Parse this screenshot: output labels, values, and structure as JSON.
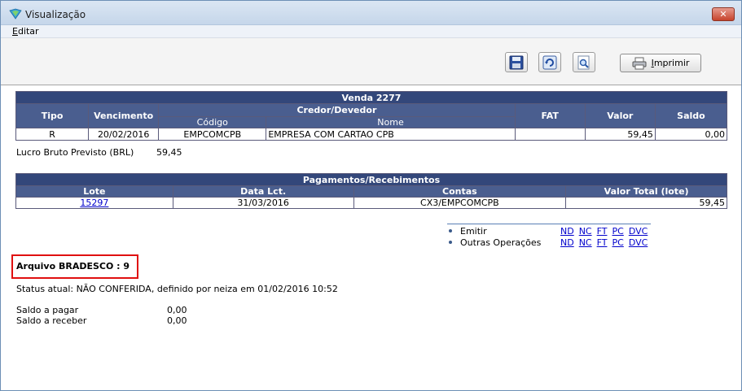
{
  "window": {
    "title": "Visualização",
    "close_label": "✕"
  },
  "menu": {
    "editar": "Editar"
  },
  "toolbar": {
    "print_label": "Imprimir"
  },
  "venda": {
    "title": "Venda  2277",
    "headers": {
      "tipo": "Tipo",
      "vencimento": "Vencimento",
      "credor_devedor": "Credor/Devedor",
      "codigo": "Código",
      "nome": "Nome",
      "fat": "FAT",
      "valor": "Valor",
      "saldo": "Saldo"
    },
    "row": {
      "tipo": "R",
      "vencimento": "20/02/2016",
      "codigo": "EMPCOMCPB",
      "nome": "EMPRESA COM CARTAO CPB",
      "fat": "",
      "valor": "59,45",
      "saldo": "0,00"
    }
  },
  "lucro": {
    "label": "Lucro Bruto Previsto (BRL)",
    "value": "59,45"
  },
  "pagamentos": {
    "title": "Pagamentos/Recebimentos",
    "headers": {
      "lote": "Lote",
      "data": "Data Lct.",
      "contas": "Contas",
      "valor_total": "Valor Total (lote)"
    },
    "row": {
      "lote": "15297",
      "data": "31/03/2016",
      "contas": "CX3/EMPCOMCPB",
      "valor_total": "59,45"
    }
  },
  "operations": [
    {
      "label": "Emitir",
      "links": [
        "ND",
        "NC",
        "FT",
        "PC",
        "DVC"
      ]
    },
    {
      "label": "Outras Operações",
      "links": [
        "ND",
        "NC",
        "FT",
        "PC",
        "DVC"
      ]
    }
  ],
  "arquivo": "Arquivo BRADESCO : 9",
  "status": "Status atual: NÃO CONFERIDA, definido por neiza em 01/02/2016 10:52",
  "saldos": [
    {
      "label": "Saldo a pagar",
      "value": "0,00"
    },
    {
      "label": "Saldo a receber",
      "value": "0,00"
    }
  ],
  "colors": {
    "header_dark": "#33477a",
    "header": "#4a5e8f",
    "highlight": "#e01010",
    "link": "#0000cc"
  }
}
